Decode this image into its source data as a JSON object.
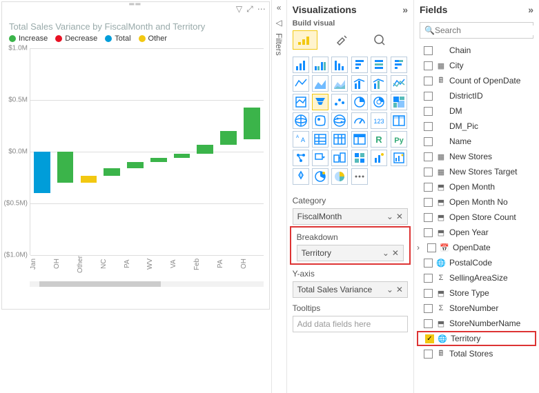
{
  "chart_data": {
    "type": "waterfall",
    "title": "Total Sales Variance by FiscalMonth and Territory",
    "ylabel": "",
    "ylim": [
      -1.0,
      1.0
    ],
    "ticks": [
      {
        "pos": 1.0,
        "label": "$1.0M"
      },
      {
        "pos": 0.5,
        "label": "$0.5M"
      },
      {
        "pos": 0.0,
        "label": "$0.0M"
      },
      {
        "pos": -0.5,
        "label": "($0.5M)"
      },
      {
        "pos": -1.0,
        "label": "($1.0M)"
      }
    ],
    "legend": [
      {
        "label": "Increase",
        "color": "#3BB44A"
      },
      {
        "label": "Decrease",
        "color": "#E81123"
      },
      {
        "label": "Total",
        "color": "#009DD9"
      },
      {
        "label": "Other",
        "color": "#F2C811"
      }
    ],
    "series": [
      {
        "x": "Jan",
        "start": 0.0,
        "end": -0.4,
        "kind": "total"
      },
      {
        "x": "OH",
        "start": 0.0,
        "end": -0.3,
        "kind": "decrease_shown_green"
      },
      {
        "x": "Other",
        "start": -0.3,
        "end": -0.23,
        "kind": "other"
      },
      {
        "x": "NC",
        "start": -0.23,
        "end": -0.16,
        "kind": "increase"
      },
      {
        "x": "PA",
        "start": -0.16,
        "end": -0.1,
        "kind": "increase"
      },
      {
        "x": "WV",
        "start": -0.1,
        "end": -0.06,
        "kind": "increase"
      },
      {
        "x": "VA",
        "start": -0.06,
        "end": -0.02,
        "kind": "increase"
      },
      {
        "x": "Feb",
        "start": -0.02,
        "end": 0.07,
        "kind": "increase"
      },
      {
        "x": "PA",
        "start": 0.07,
        "end": 0.2,
        "kind": "increase"
      },
      {
        "x": "OH",
        "start": 0.12,
        "end": 0.43,
        "kind": "increase"
      }
    ]
  },
  "viz": {
    "pane_title": "Visualizations",
    "build": "Build visual",
    "wells": {
      "category_label": "Category",
      "category_value": "FiscalMonth",
      "breakdown_label": "Breakdown",
      "breakdown_value": "Territory",
      "yaxis_label": "Y-axis",
      "yaxis_value": "Total Sales Variance",
      "tooltips_label": "Tooltips",
      "tooltips_placeholder": "Add data fields here"
    }
  },
  "filters": {
    "label": "Filters"
  },
  "fields": {
    "pane_title": "Fields",
    "search_placeholder": "Search",
    "items": [
      {
        "label": "Chain",
        "icon": ""
      },
      {
        "label": "City",
        "icon": "tbl"
      },
      {
        "label": "Count of OpenDate",
        "icon": "calc"
      },
      {
        "label": "DistrictID",
        "icon": ""
      },
      {
        "label": "DM",
        "icon": ""
      },
      {
        "label": "DM_Pic",
        "icon": ""
      },
      {
        "label": "Name",
        "icon": ""
      },
      {
        "label": "New Stores",
        "icon": "tbl"
      },
      {
        "label": "New Stores Target",
        "icon": "tbl"
      },
      {
        "label": "Open Month",
        "icon": "hier"
      },
      {
        "label": "Open Month No",
        "icon": "hier"
      },
      {
        "label": "Open Store Count",
        "icon": "hier"
      },
      {
        "label": "Open Year",
        "icon": "hier"
      },
      {
        "label": "OpenDate",
        "icon": "cal",
        "expandable": true
      },
      {
        "label": "PostalCode",
        "icon": "globe"
      },
      {
        "label": "SellingAreaSize",
        "icon": "sum"
      },
      {
        "label": "Store Type",
        "icon": "hier"
      },
      {
        "label": "StoreNumber",
        "icon": "sum"
      },
      {
        "label": "StoreNumberName",
        "icon": "hier"
      },
      {
        "label": "Territory",
        "icon": "globe",
        "checked": true,
        "highlight": true
      },
      {
        "label": "Total Stores",
        "icon": "calc"
      }
    ]
  }
}
